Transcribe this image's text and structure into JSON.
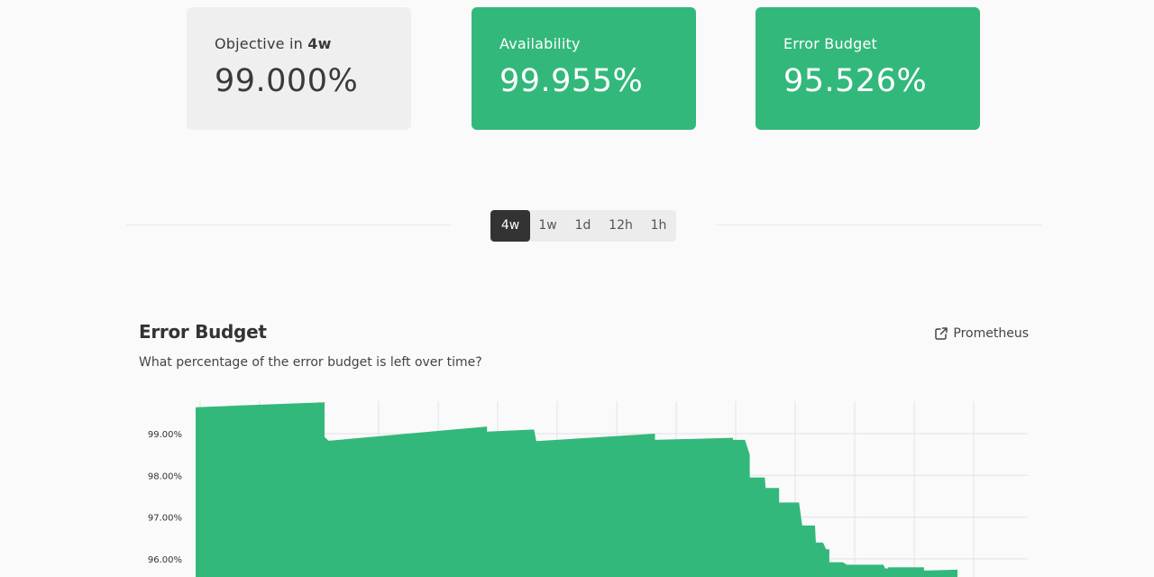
{
  "cards": [
    {
      "label_prefix": "Objective in",
      "label_bold": "4w",
      "value": "99.000%",
      "variant": "neutral"
    },
    {
      "label": "Availability",
      "value": "99.955%",
      "variant": "good"
    },
    {
      "label": "Error Budget",
      "value": "95.526%",
      "variant": "good"
    }
  ],
  "range_selector": {
    "options": [
      "4w",
      "1w",
      "1d",
      "12h",
      "1h"
    ],
    "selected": "4w"
  },
  "error_budget_section": {
    "title": "Error Budget",
    "description": "What percentage of the error budget is left over time?",
    "link_label": "Prometheus",
    "link_icon": "external-link-icon"
  },
  "colors": {
    "good": "#33b87b",
    "neutral_card": "#efefef",
    "selected_range": "#333333"
  },
  "chart_data": {
    "type": "area",
    "ylim": [
      95.6,
      100.0
    ],
    "y_ticks": [
      "99.00%",
      "98.00%",
      "97.00%",
      "96.00%"
    ],
    "y_tick_values": [
      99,
      98,
      97,
      96
    ],
    "grid": true,
    "series": [
      {
        "values": [
          [
            0.0,
            99.63
          ],
          [
            0.062,
            99.68
          ],
          [
            0.162,
            99.75
          ],
          [
            0.162,
            98.92
          ],
          [
            0.167,
            98.83
          ],
          [
            0.366,
            99.17
          ],
          [
            0.366,
            99.05
          ],
          [
            0.425,
            99.1
          ],
          [
            0.428,
            98.82
          ],
          [
            0.577,
            99.0
          ],
          [
            0.577,
            98.85
          ],
          [
            0.675,
            98.9
          ],
          [
            0.675,
            98.85
          ],
          [
            0.69,
            98.85
          ],
          [
            0.696,
            98.5
          ],
          [
            0.696,
            97.95
          ],
          [
            0.715,
            97.95
          ],
          [
            0.716,
            97.7
          ],
          [
            0.733,
            97.7
          ],
          [
            0.733,
            97.35
          ],
          [
            0.758,
            97.35
          ],
          [
            0.762,
            96.8
          ],
          [
            0.778,
            96.8
          ],
          [
            0.779,
            96.39
          ],
          [
            0.788,
            96.39
          ],
          [
            0.792,
            96.23
          ],
          [
            0.796,
            96.23
          ],
          [
            0.796,
            95.92
          ],
          [
            0.813,
            95.92
          ],
          [
            0.818,
            95.86
          ],
          [
            0.864,
            95.86
          ],
          [
            0.866,
            95.77
          ],
          [
            0.87,
            95.77
          ],
          [
            0.87,
            95.8
          ],
          [
            0.915,
            95.8
          ],
          [
            0.915,
            95.72
          ],
          [
            0.957,
            95.74
          ],
          [
            0.957,
            95.62
          ]
        ]
      }
    ]
  }
}
